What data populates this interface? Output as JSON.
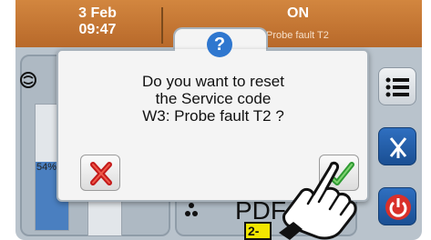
{
  "header": {
    "date": "3 Feb",
    "time": "09:47",
    "status": "ON",
    "fault": "Probe fault T2"
  },
  "background": {
    "bar_level_label": "54%",
    "bar_level": 0.54,
    "display_text": "PDF"
  },
  "dialog": {
    "help_glyph": "?",
    "message_lines": [
      "Do you want to reset",
      "the Service code",
      "W3: Probe fault T2 ?"
    ]
  },
  "overlay": {
    "step_label": "2-"
  },
  "icons": {
    "help": "question-icon",
    "cancel": "cross-icon",
    "confirm": "checkmark-icon",
    "menu": "list-menu-icon",
    "valve": "valve-icon",
    "power": "power-icon",
    "compressor": "compressor-icon",
    "fan": "fan-icon",
    "hand": "pointing-hand-icon"
  },
  "colors": {
    "header": "#c47734",
    "accent_blue": "#2f77cf",
    "cancel_red": "#d02020",
    "confirm_green": "#38a83a",
    "badge_yellow": "#f2e600"
  }
}
